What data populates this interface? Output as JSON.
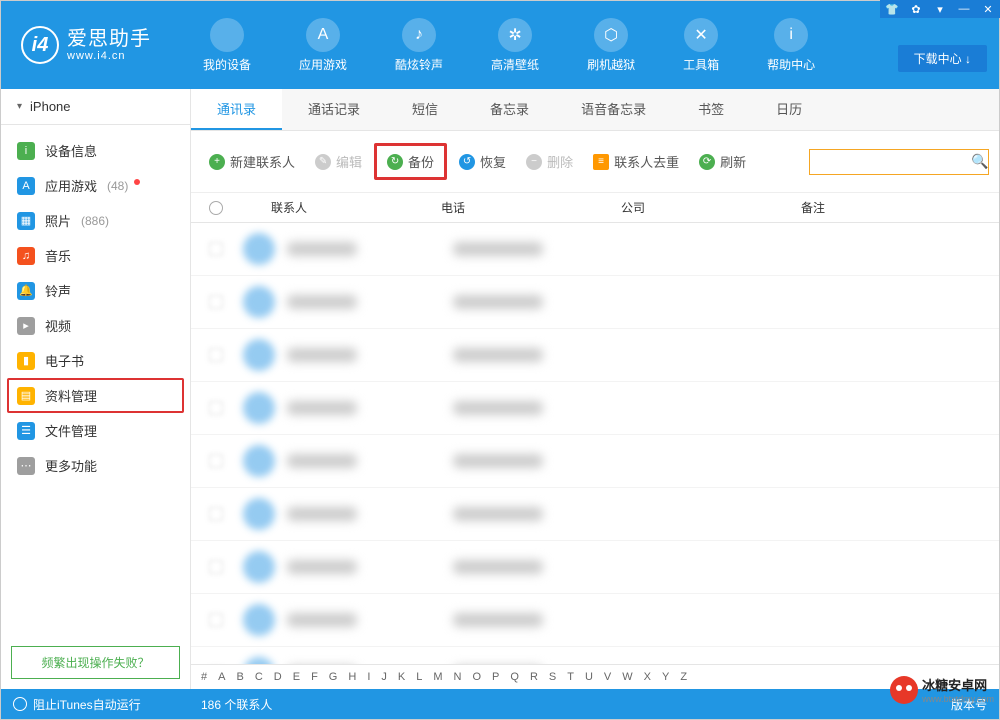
{
  "app": {
    "title": "爱思助手",
    "url": "www.i4.cn",
    "download_center": "下载中心 ↓"
  },
  "topnav": [
    {
      "label": "我的设备",
      "icon": ""
    },
    {
      "label": "应用游戏",
      "icon": "A"
    },
    {
      "label": "酷炫铃声",
      "icon": "♪"
    },
    {
      "label": "高清壁纸",
      "icon": "✲"
    },
    {
      "label": "刷机越狱",
      "icon": "⬡"
    },
    {
      "label": "工具箱",
      "icon": "✕"
    },
    {
      "label": "帮助中心",
      "icon": "i"
    }
  ],
  "device": {
    "name": "iPhone"
  },
  "sidebar": [
    {
      "label": "设备信息",
      "count": "",
      "color": "#4caf50",
      "icon": "i"
    },
    {
      "label": "应用游戏",
      "count": "(48)",
      "color": "#2196e3",
      "icon": "A",
      "dot": true
    },
    {
      "label": "照片",
      "count": "(886)",
      "color": "#2196e3",
      "icon": "▦"
    },
    {
      "label": "音乐",
      "count": "",
      "color": "#f4511e",
      "icon": "♫"
    },
    {
      "label": "铃声",
      "count": "",
      "color": "#2196e3",
      "icon": "🔔"
    },
    {
      "label": "视频",
      "count": "",
      "color": "#9e9e9e",
      "icon": "▸"
    },
    {
      "label": "电子书",
      "count": "",
      "color": "#ffb300",
      "icon": "▮"
    },
    {
      "label": "资料管理",
      "count": "",
      "color": "#ffb300",
      "icon": "▤",
      "highlight": true
    },
    {
      "label": "文件管理",
      "count": "",
      "color": "#2196e3",
      "icon": "☰"
    },
    {
      "label": "更多功能",
      "count": "",
      "color": "#9e9e9e",
      "icon": "⋯"
    }
  ],
  "sidebar_footer": "频繁出现操作失败？",
  "subtabs": [
    {
      "label": "通讯录",
      "active": true
    },
    {
      "label": "通话记录"
    },
    {
      "label": "短信"
    },
    {
      "label": "备忘录"
    },
    {
      "label": "语音备忘录"
    },
    {
      "label": "书签"
    },
    {
      "label": "日历"
    }
  ],
  "toolbar": {
    "new_contact": "新建联系人",
    "edit": "编辑",
    "backup": "备份",
    "restore": "恢复",
    "delete": "删除",
    "dedupe": "联系人去重",
    "refresh": "刷新"
  },
  "table": {
    "headers": {
      "contact": "联系人",
      "phone": "电话",
      "company": "公司",
      "note": "备注"
    },
    "row_count": 9
  },
  "index_letters": [
    "#",
    "A",
    "B",
    "C",
    "D",
    "E",
    "F",
    "G",
    "H",
    "I",
    "J",
    "K",
    "L",
    "M",
    "N",
    "O",
    "P",
    "Q",
    "R",
    "S",
    "T",
    "U",
    "V",
    "W",
    "X",
    "Y",
    "Z"
  ],
  "statusbar": {
    "left": "阻止iTunes自动运行",
    "mid": "186 个联系人",
    "right": "版本号"
  },
  "watermark": {
    "main": "冰糖安卓网",
    "sub": "www.btxtdmy.com"
  }
}
